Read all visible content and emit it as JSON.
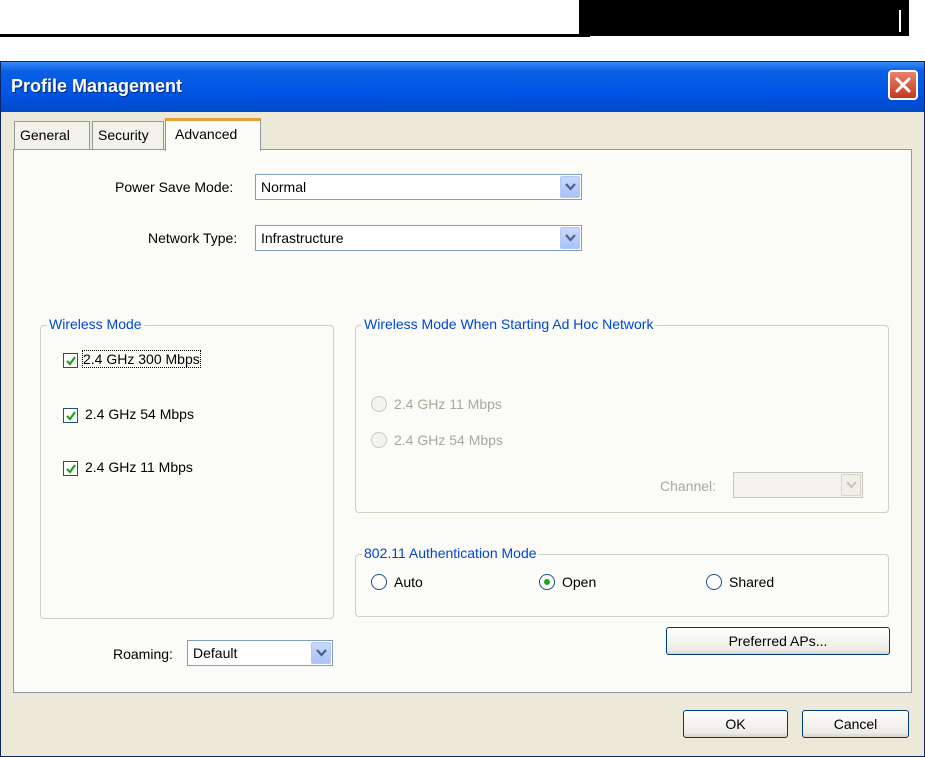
{
  "window": {
    "title": "Profile Management"
  },
  "tabs": [
    {
      "label": "General",
      "active": false
    },
    {
      "label": "Security",
      "active": false
    },
    {
      "label": "Advanced",
      "active": true
    }
  ],
  "power_save": {
    "label": "Power Save Mode:",
    "value": "Normal"
  },
  "network_type": {
    "label": "Network Type:",
    "value": "Infrastructure"
  },
  "wireless_mode": {
    "title": "Wireless Mode",
    "options": [
      {
        "label": "2.4 GHz 300 Mbps",
        "checked": true
      },
      {
        "label": "2.4 GHz 54 Mbps",
        "checked": true
      },
      {
        "label": "2.4 GHz 11 Mbps",
        "checked": true
      }
    ]
  },
  "adhoc_mode": {
    "title": "Wireless Mode When Starting Ad Hoc Network",
    "options": [
      {
        "label": "2.4 GHz 11 Mbps",
        "selected": false,
        "enabled": false
      },
      {
        "label": "2.4 GHz 54 Mbps",
        "selected": false,
        "enabled": false
      }
    ],
    "channel_label": "Channel:",
    "channel_value": ""
  },
  "auth_mode": {
    "title": "802.11 Authentication Mode",
    "options": [
      {
        "label": "Auto",
        "selected": false
      },
      {
        "label": "Open",
        "selected": true
      },
      {
        "label": "Shared",
        "selected": false
      }
    ]
  },
  "roaming": {
    "label": "Roaming:",
    "value": "Default"
  },
  "buttons": {
    "preferred_aps": "Preferred APs...",
    "ok": "OK",
    "cancel": "Cancel"
  },
  "colors": {
    "titlebar": "#0055e5",
    "group_title": "#0046d5",
    "tab_highlight": "#e7a13a",
    "radio_dot": "#21a121"
  }
}
